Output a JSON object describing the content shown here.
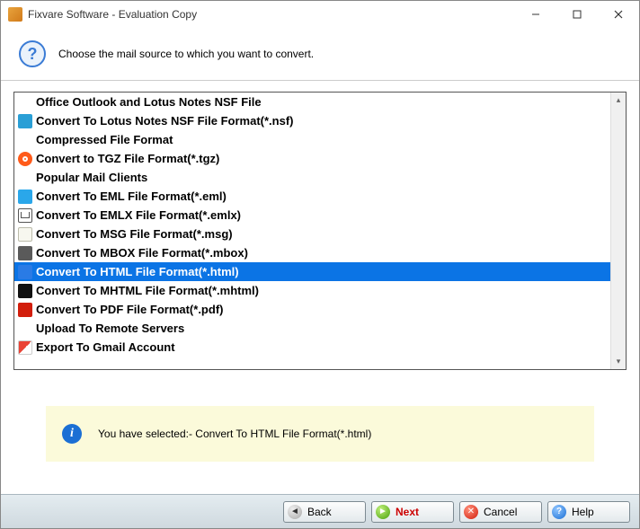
{
  "window": {
    "title": "Fixvare Software - Evaluation Copy"
  },
  "header": {
    "instruction": "Choose the mail source to which you want to convert."
  },
  "list": {
    "items": [
      {
        "label": "Office Outlook and Lotus Notes NSF File",
        "type": "header",
        "icon": "none"
      },
      {
        "label": "Convert To Lotus Notes NSF File Format(*.nsf)",
        "type": "option",
        "icon": "nsf"
      },
      {
        "label": "Compressed File Format",
        "type": "header",
        "icon": "none"
      },
      {
        "label": "Convert to TGZ File Format(*.tgz)",
        "type": "option",
        "icon": "tgz"
      },
      {
        "label": "Popular Mail Clients",
        "type": "header",
        "icon": "none"
      },
      {
        "label": "Convert To EML File Format(*.eml)",
        "type": "option",
        "icon": "eml"
      },
      {
        "label": "Convert To EMLX File Format(*.emlx)",
        "type": "option",
        "icon": "emlx"
      },
      {
        "label": "Convert To MSG File Format(*.msg)",
        "type": "option",
        "icon": "msg"
      },
      {
        "label": "Convert To MBOX File Format(*.mbox)",
        "type": "option",
        "icon": "mbox"
      },
      {
        "label": "Convert To HTML File Format(*.html)",
        "type": "option",
        "icon": "html",
        "selected": true
      },
      {
        "label": "Convert To MHTML File Format(*.mhtml)",
        "type": "option",
        "icon": "mhtml"
      },
      {
        "label": "Convert To PDF File Format(*.pdf)",
        "type": "option",
        "icon": "pdf"
      },
      {
        "label": "Upload To Remote Servers",
        "type": "header",
        "icon": "none"
      },
      {
        "label": "Export To Gmail Account",
        "type": "option",
        "icon": "gmail"
      }
    ]
  },
  "info": {
    "text": "You have selected:- Convert To HTML File Format(*.html)"
  },
  "footer": {
    "back": "Back",
    "next": "Next",
    "cancel": "Cancel",
    "help": "Help"
  }
}
